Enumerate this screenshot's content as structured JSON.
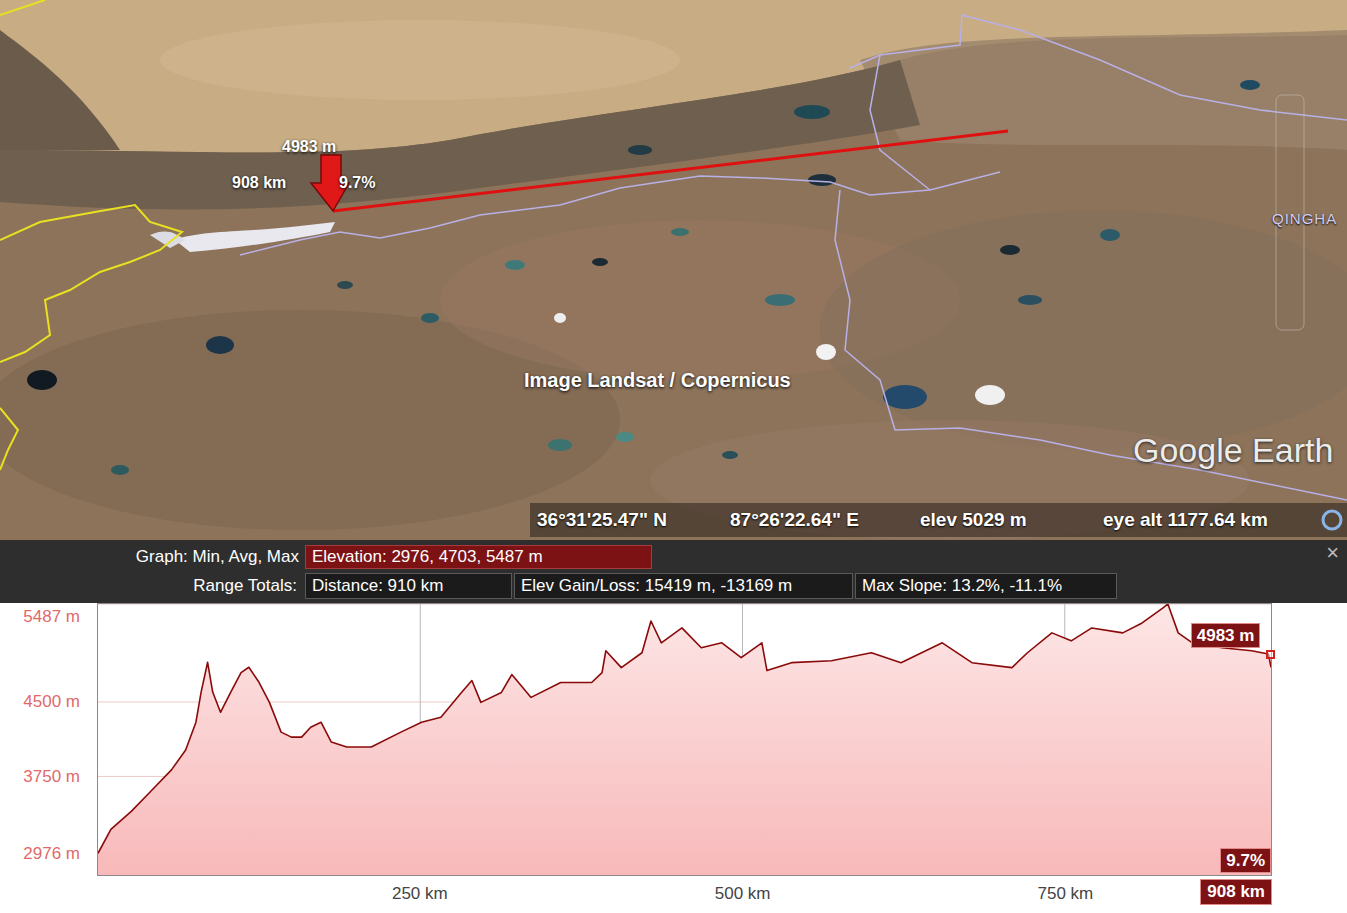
{
  "map": {
    "cursor_label": {
      "elevation": "4983 m",
      "distance": "908 km",
      "slope": "9.7%"
    },
    "region_label": "QINGHA",
    "imagery_credit": "Image Landsat / Copernicus",
    "logo": "Google Earth",
    "status_bar": {
      "latitude": "36°31'25.47\" N",
      "longitude": "87°26'22.64\" E",
      "elevation": "elev 5029 m",
      "eye_altitude": "eye alt 1177.64 km"
    }
  },
  "profile": {
    "graph_label": "Graph: Min, Avg, Max",
    "elevation_summary": "Elevation: 2976, 4703, 5487 m",
    "range_label": "Range Totals:",
    "totals": [
      "Distance: 910 km",
      "Elev Gain/Loss: 15419 m, -13169 m",
      "Max Slope: 13.2%, -11.1%"
    ],
    "close": "×",
    "y_ticks": [
      {
        "label": "5487 m",
        "value": 5487
      },
      {
        "label": "4500 m",
        "value": 4500
      },
      {
        "label": "3750 m",
        "value": 3750
      },
      {
        "label": "2976 m",
        "value": 2976
      }
    ],
    "x_ticks": [
      {
        "label": "250 km",
        "value": 250
      },
      {
        "label": "500 km",
        "value": 500
      },
      {
        "label": "750 km",
        "value": 750
      }
    ],
    "series": {
      "distance_km": [
        0,
        10,
        26,
        41,
        57,
        68,
        76,
        80,
        85,
        89,
        95,
        103,
        111,
        117,
        125,
        133,
        142,
        150,
        158,
        165,
        173,
        181,
        193,
        212,
        235,
        251,
        266,
        282,
        290,
        297,
        313,
        321,
        336,
        359,
        383,
        391,
        394,
        406,
        422,
        429,
        437,
        453,
        468,
        484,
        499,
        515,
        519,
        538,
        569,
        600,
        623,
        655,
        678,
        709,
        721,
        740,
        755,
        771,
        795,
        810,
        826,
        830,
        838,
        849,
        872,
        895,
        908,
        910
      ],
      "elevation_m": [
        2976,
        3216,
        3400,
        3600,
        3816,
        4016,
        4296,
        4600,
        4900,
        4600,
        4396,
        4600,
        4796,
        4850,
        4696,
        4496,
        4196,
        4146,
        4146,
        4246,
        4296,
        4096,
        4046,
        4046,
        4196,
        4296,
        4346,
        4596,
        4716,
        4496,
        4596,
        4776,
        4546,
        4696,
        4696,
        4796,
        5016,
        4846,
        4996,
        5316,
        5096,
        5246,
        5046,
        5096,
        4946,
        5096,
        4816,
        4896,
        4916,
        4996,
        4896,
        5096,
        4896,
        4846,
        4996,
        5196,
        5116,
        5246,
        5196,
        5296,
        5446,
        5487,
        5196,
        5096,
        5046,
        5016,
        4983,
        4850
      ]
    },
    "cursor": {
      "elevation": "4983 m",
      "slope": "9.7%",
      "distance": "908 km",
      "distance_km": 908,
      "elevation_m": 4983
    }
  }
}
